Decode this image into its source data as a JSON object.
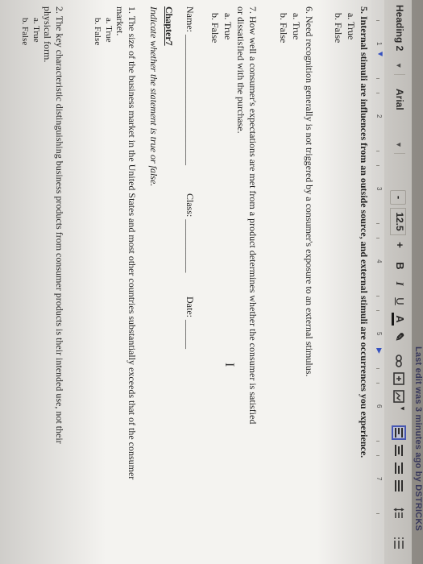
{
  "status": {
    "autosave": "Last edit was 3 minutes ago by DSTRICKS"
  },
  "toolbar": {
    "style": "Heading 2",
    "font": "Arial",
    "minus": "-",
    "size": "12.5",
    "plus": "+",
    "bold": "B",
    "italic": "I",
    "underline": "U",
    "textcolor": "A"
  },
  "ruler": {
    "marks": [
      "1",
      "2",
      "3",
      "4",
      "5",
      "6",
      "7"
    ]
  },
  "doc": {
    "q5": "5. Internal stimuli are influences from an outside source, and external stimuli are occurrences you experience.",
    "q5a": "a. True",
    "q5b": "b. False",
    "q6": "6. Need recognition generally is not triggered by a consumer's exposure to an external stimulus.",
    "q6a": "a. True",
    "q6b": "b. False",
    "q7_l1": "7.       How well a consumer's expectations are met from a product determines whether the consumer is satisfied",
    "q7_l2": "or dissatisfied with the purchase.",
    "q7a": "a. True",
    "q7b": "b. False",
    "name": "Name: ___________________________",
    "class": "Class: ___________",
    "date": "Date: ______",
    "chapter": "Chapter7",
    "instr": "Indicate whether the statement is true or false.",
    "p1_l1": "1.    The size of the business market in the United States and most other countries substantially exceeds that of the consumer",
    "p1_l2": "market.",
    "p1a": "a. True",
    "p1b": "b. False",
    "p2_l1": "2.       The key characteristic distinguishing business products from consumer products is their intended use, not their",
    "p2_l2": "physical form.",
    "p2a": "a. True",
    "p2b": "b. False"
  }
}
